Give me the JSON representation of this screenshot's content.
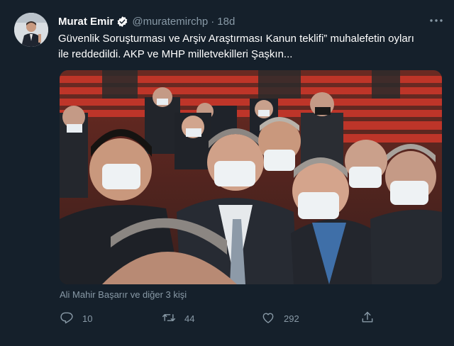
{
  "author": {
    "name": "Murat Emir",
    "handle": "@muratemirchp",
    "date": "18d",
    "separator": "·",
    "verified": true
  },
  "tweet": {
    "line1": "Güvenlik Soruşturması ve Arşiv Araştırması Kanun teklifi” muhalefetin oyları",
    "line2": "ile reddedildi. AKP ve MHP milletvekilleri Şaşkın..."
  },
  "media": {
    "type": "group-selfie-photo"
  },
  "tagged_people": "Ali Mahir Başarır ve diğer 3 kişi",
  "actions": {
    "reply_count": "10",
    "retweet_count": "44",
    "like_count": "292"
  },
  "colors": {
    "background": "#15202b",
    "secondary_text": "#8899a6",
    "primary_text": "#ffffff",
    "verified_badge": "#ffffff"
  },
  "icons": [
    "verified-icon",
    "more-options-icon",
    "reply-icon",
    "retweet-icon",
    "like-icon",
    "share-icon"
  ]
}
